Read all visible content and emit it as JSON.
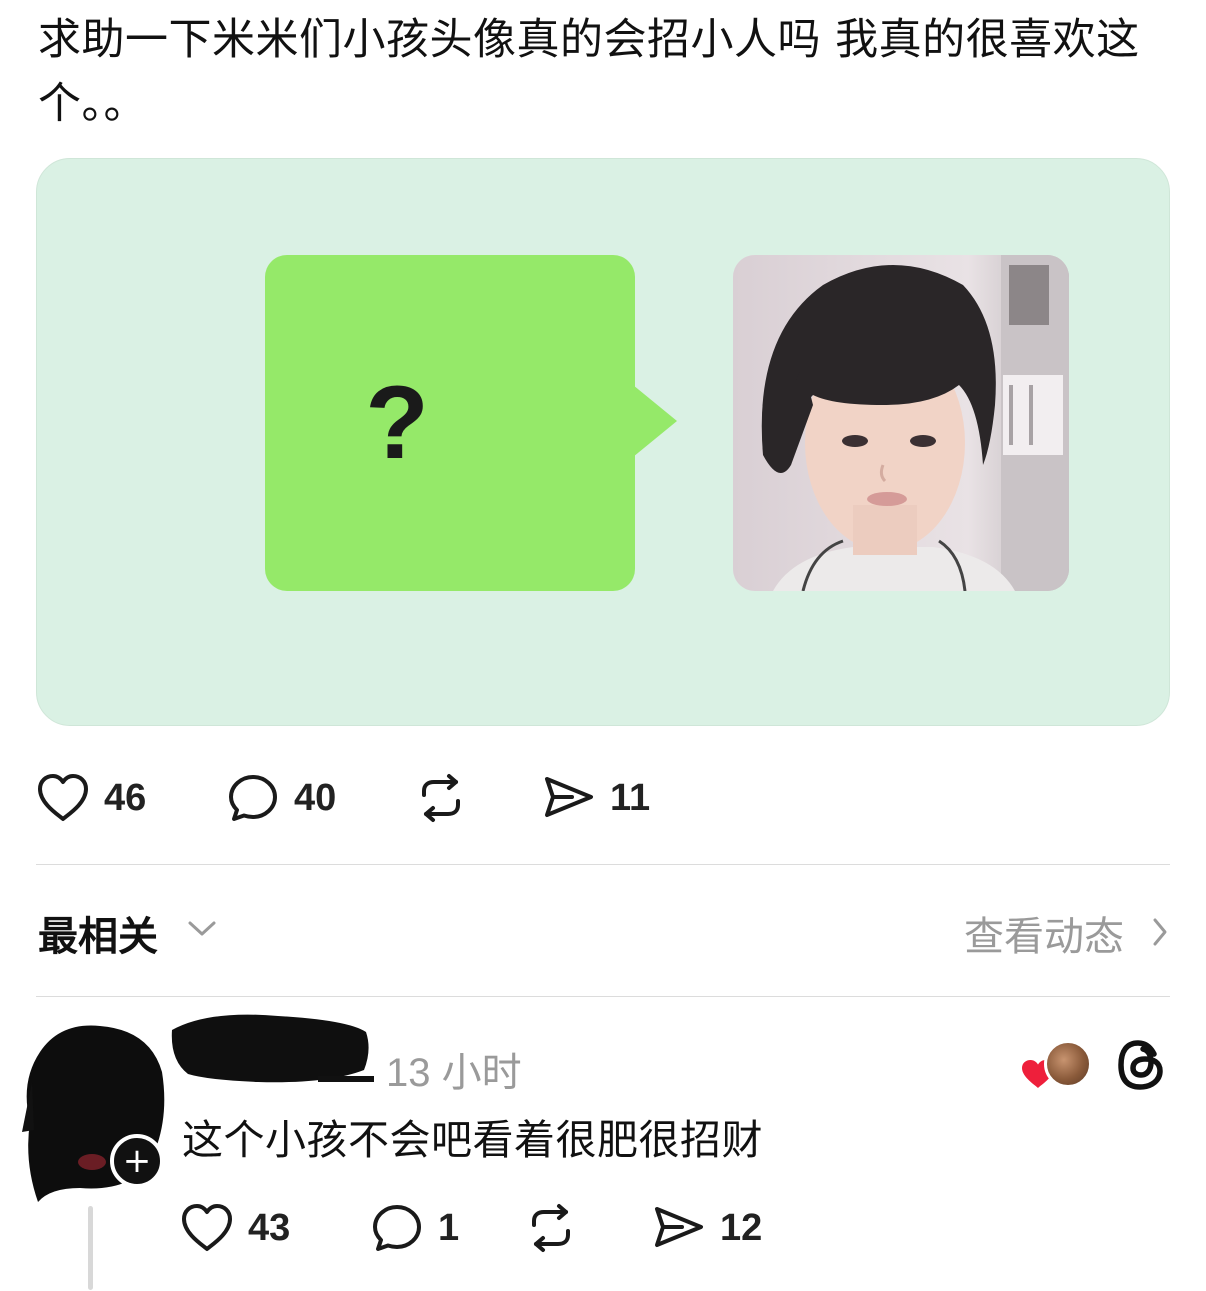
{
  "post": {
    "text": "求助一下米米们小孩头像真的会招小人吗 我真的很喜欢这个。。",
    "media": {
      "bubble_symbol": "?",
      "colors": {
        "card_bg": "#daf1e4",
        "bubble": "#95e969"
      }
    },
    "stats": {
      "likes": "46",
      "replies": "40",
      "shares": "11"
    }
  },
  "sort": {
    "label": "最相关",
    "activity_link": "查看动态"
  },
  "comment": {
    "time": "13 小时",
    "text": "这个小孩不会吧看着很肥很招财",
    "follow_symbol": "+",
    "stats": {
      "likes": "43",
      "replies": "1",
      "shares": "12"
    },
    "colors": {
      "liked_heart": "#ee1f3b"
    }
  }
}
